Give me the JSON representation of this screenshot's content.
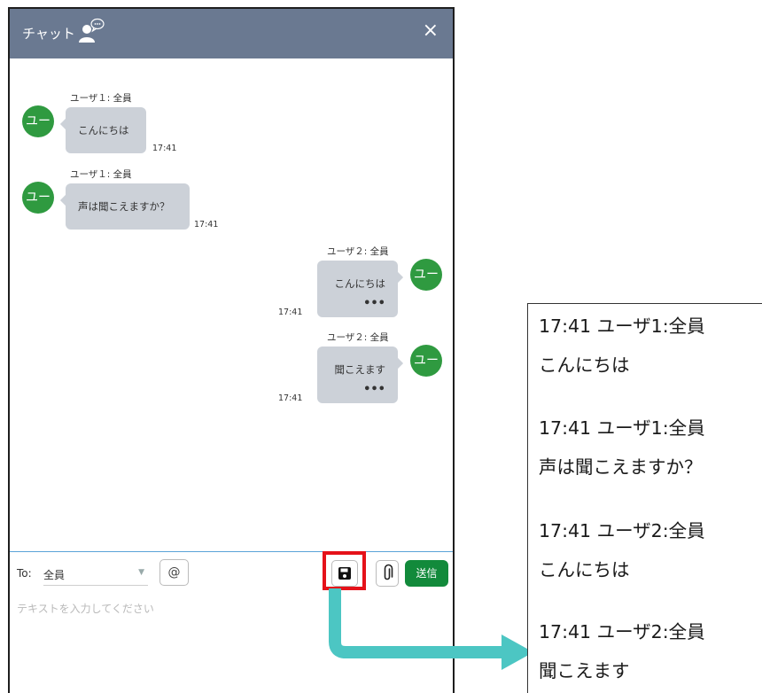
{
  "header": {
    "title": "チャット",
    "icon": "user-chat-icon",
    "close_label": "×"
  },
  "messages": [
    {
      "sender": "ユーザ１: 全員",
      "avatar": "ユー",
      "text": "こんにちは",
      "time": "17:41",
      "side": "left"
    },
    {
      "sender": "ユーザ１: 全員",
      "avatar": "ユー",
      "text": "声は聞こえますか？",
      "time": "17:41",
      "side": "left"
    },
    {
      "sender": "ユーザ２: 全員",
      "avatar": "ユー",
      "text": "こんにちは",
      "time": "17:41",
      "side": "right",
      "more": "•••"
    },
    {
      "sender": "ユーザ２: 全員",
      "avatar": "ユー",
      "text": "聞こえます",
      "time": "17:41",
      "side": "right",
      "more": "•••"
    }
  ],
  "composer": {
    "to_label": "To:",
    "to_value": "全員",
    "mention_label": "@",
    "save_icon": "save-icon",
    "attach_icon": "paperclip-icon",
    "send_label": "送信",
    "placeholder": "テキストを入力してください",
    "highlight_color": "#e5121a"
  },
  "export": {
    "lines": [
      {
        "header": "17:41 ユーザ1:全員",
        "message": "こんにちは"
      },
      {
        "header": "17:41 ユーザ1:全員",
        "message": "声は聞こえますか？"
      },
      {
        "header": "17:41 ユーザ2:全員",
        "message": "こんにちは"
      },
      {
        "header": "17:41 ユーザ2:全員",
        "message": "聞こえます"
      }
    ]
  },
  "colors": {
    "header_bg": "#6a7991",
    "avatar": "#2f9a40",
    "bubble": "#ccd1d8",
    "send": "#128a3b",
    "arrow": "#4cc6c3"
  }
}
